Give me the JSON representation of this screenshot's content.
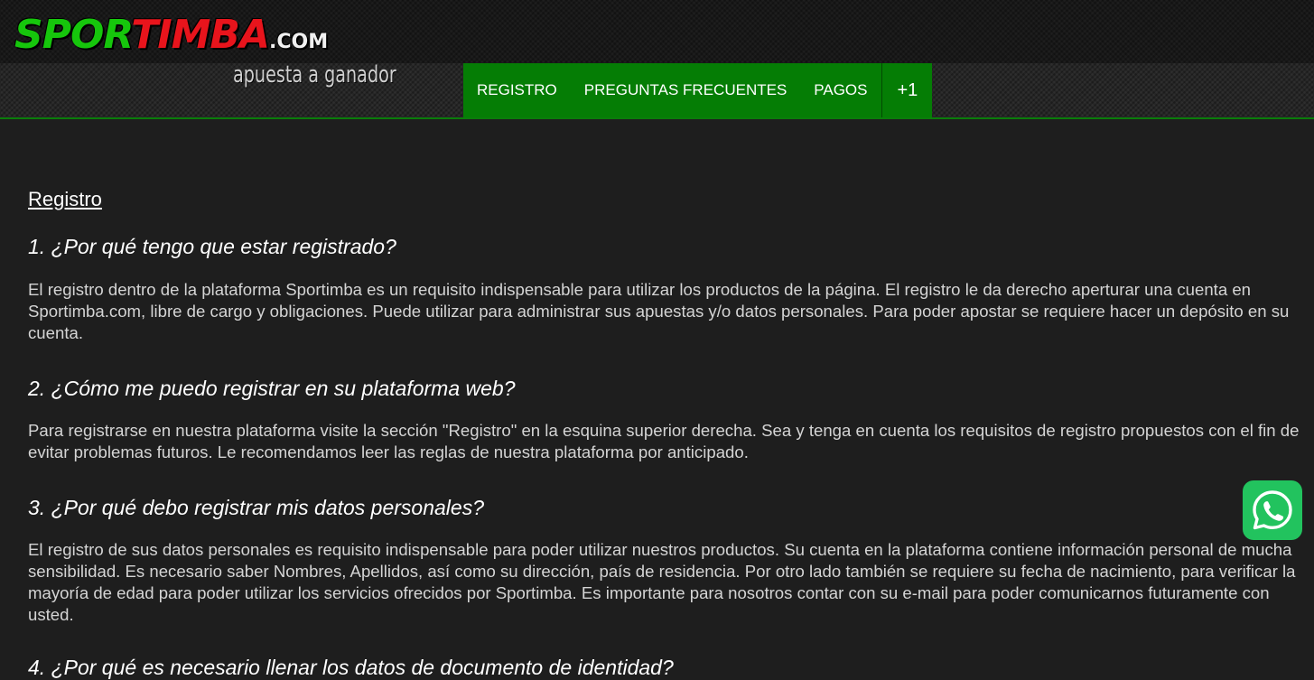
{
  "brand": {
    "logo_sport": "SPOR",
    "logo_timba": "TIMBA",
    "logo_com": ".COM",
    "tagline": "apuesta a ganador"
  },
  "nav": {
    "items": [
      {
        "label": "REGISTRO"
      },
      {
        "label": "PREGUNTAS FRECUENTES"
      },
      {
        "label": "PAGOS"
      }
    ],
    "more_label": "+1"
  },
  "content": {
    "section_title": "Registro",
    "faqs": [
      {
        "question": "1. ¿Por qué tengo que estar registrado?",
        "answer": "El registro dentro de la plataforma Sportimba es un requisito indispensable para utilizar los productos de la página. El registro le da derecho aperturar una cuenta en Sportimba.com, libre de cargo y obligaciones. Puede utilizar para administrar sus apuestas y/o datos personales. Para poder apostar se requiere hacer un depósito en su cuenta."
      },
      {
        "question": "2. ¿Cómo me puedo registrar en su plataforma web?",
        "answer": "Para registrarse en nuestra plataforma visite la sección \"Registro\" en la esquina superior derecha. Sea y tenga en cuenta los requisitos de registro propuestos con el fin de evitar problemas futuros. Le recomendamos leer las reglas de nuestra plataforma por anticipado."
      },
      {
        "question": "3. ¿Por qué debo registrar mis datos personales?",
        "answer": "El registro de sus datos personales es requisito indispensable para poder utilizar nuestros productos. Su cuenta en la plataforma contiene información personal de mucha sensibilidad. Es necesario saber Nombres, Apellidos, así como su dirección, país de residencia. Por otro lado también se requiere su fecha de nacimiento, para verificar la mayoría de edad para poder utilizar los servicios ofrecidos por Sportimba. Es importante para nosotros contar con su e-mail para poder comunicarnos futuramente con usted."
      },
      {
        "question": "4. ¿Por qué es necesario llenar los datos de documento de identidad?"
      }
    ]
  },
  "colors": {
    "nav_bg": "#057d05",
    "page_bg": "#1e1e1e",
    "whatsapp_green": "#22c35e",
    "logo_green": "#16c60c",
    "logo_red": "#e8141c"
  },
  "icons": {
    "whatsapp": "whatsapp-icon"
  }
}
